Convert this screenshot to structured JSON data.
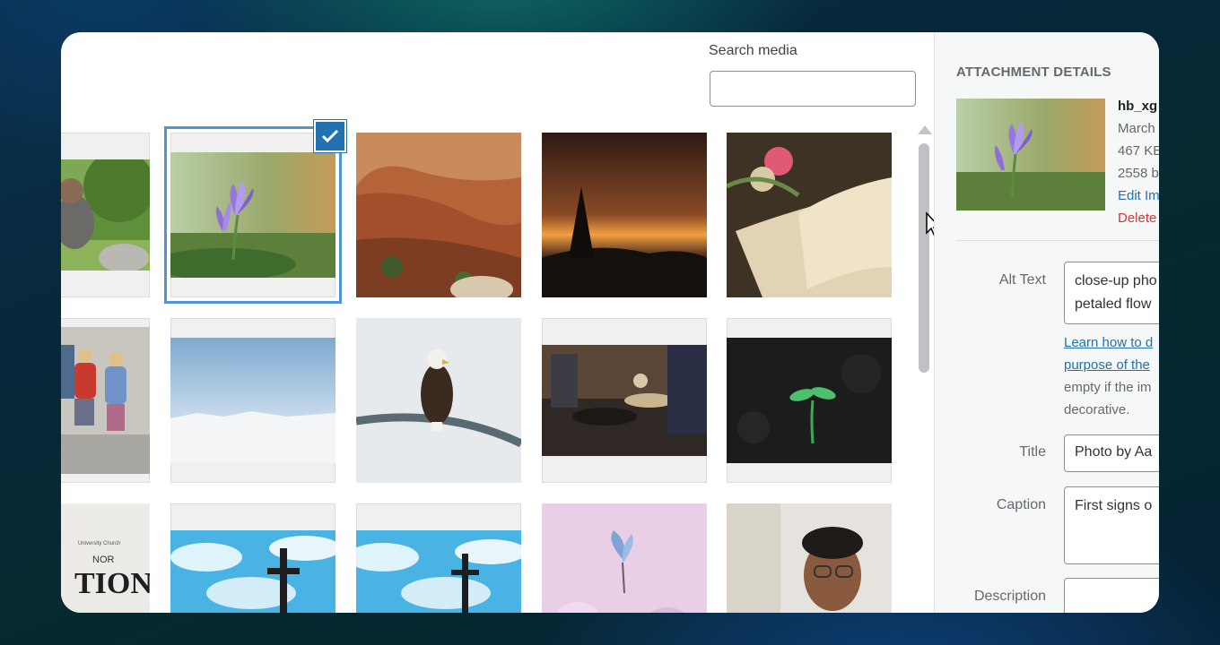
{
  "search": {
    "label": "Search media",
    "value": ""
  },
  "grid": {
    "items": [
      {
        "subject": "man on grass"
      },
      {
        "subject": "purple crocus flower",
        "selected": true
      },
      {
        "subject": "red rock canyon"
      },
      {
        "subject": "sunset over trees"
      },
      {
        "subject": "open book with tulips"
      },
      {
        "subject": "children with backpacks"
      },
      {
        "subject": "snowy landscape"
      },
      {
        "subject": "bald eagle on branch"
      },
      {
        "subject": "buffet food line"
      },
      {
        "subject": "green seedling on dark soil"
      },
      {
        "subject": "event flyer text",
        "text_partial": "TION",
        "small_text_1": "University Church",
        "small_text_2": "NOR"
      },
      {
        "subject": "cross against blue sky"
      },
      {
        "subject": "cross against blue sky"
      },
      {
        "subject": "butterfly on pink flowers"
      },
      {
        "subject": "man with glasses"
      }
    ]
  },
  "colors": {
    "accent": "#2271b1",
    "selection_outline": "#4f94d4",
    "delete": "#d63638"
  },
  "sidebar": {
    "heading": "ATTACHMENT DETAILS",
    "filename": "hb_xg",
    "date": "March",
    "filesize": "467 KE",
    "dimensions": "2558 b",
    "edit_link": "Edit Im",
    "delete_link": "Delete",
    "alt_text": {
      "label": "Alt Text",
      "line1": "close-up pho",
      "line2": "petaled flow"
    },
    "help": {
      "link_line1": "Learn how to d",
      "link_line2": "purpose of the",
      "text_line1": "empty if the im",
      "text_line2": "decorative."
    },
    "title": {
      "label": "Title",
      "value": "Photo by Aa"
    },
    "caption": {
      "label": "Caption",
      "value": "First signs o"
    },
    "description": {
      "label": "Description",
      "value": ""
    }
  }
}
